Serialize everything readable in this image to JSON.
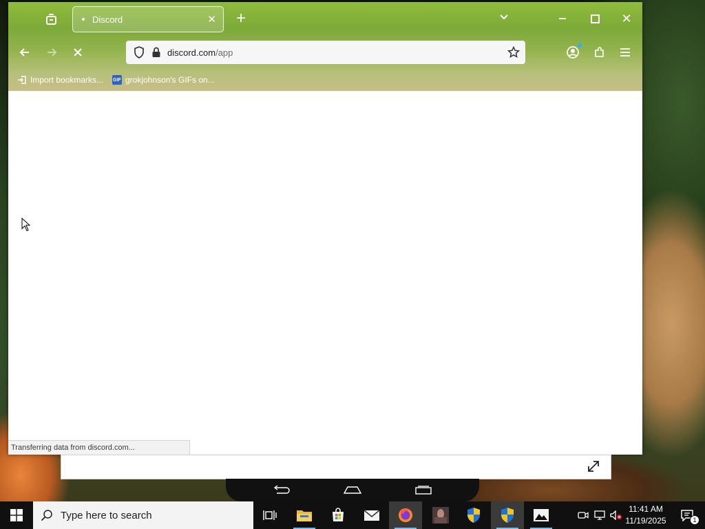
{
  "browser": {
    "tab": {
      "title": "Discord"
    },
    "address": {
      "host": "discord.com",
      "path": "/app"
    },
    "bookmarks": [
      {
        "label": "Import bookmarks..."
      },
      {
        "label": "grokjohnson's GIFs on...",
        "badge": "GIF"
      }
    ],
    "status_text": "Transferring data from discord.com..."
  },
  "taskbar": {
    "search_placeholder": "Type here to search",
    "apps": [
      "task-view",
      "file-explorer",
      "microsoft-store",
      "mail",
      "firefox",
      "media-app",
      "security-shield",
      "security-shield",
      "photos"
    ],
    "clock": {
      "time": "11:41 AM",
      "date": "11/19/2025"
    },
    "notification_count": "1"
  },
  "colors": {
    "accent": "#76b9ed",
    "chrome_green": "#8fbc3b",
    "gif_badge": "#2a63c9"
  }
}
